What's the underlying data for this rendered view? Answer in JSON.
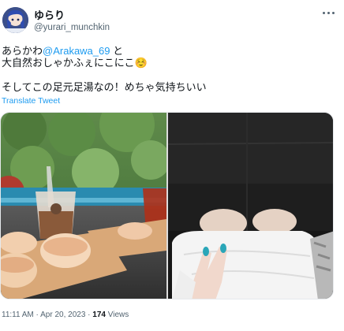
{
  "tweet": {
    "display_name": "ゆらり",
    "handle": "@yurari_munchkin",
    "line1_prefix": "あらかわ",
    "mention": "@Arakawa_69",
    "line1_suffix": " と",
    "line2": "大自然おしゃかふぇにこにこ☺️",
    "line3": "そしてこの足元足湯なの！めちゃ気持ちいい",
    "translate_label": "Translate Tweet",
    "time": "11:11 AM",
    "separator": " · ",
    "date": "Apr 20, 2023",
    "views_count": "174",
    "views_label": " Views"
  },
  "icons": {
    "more": "more-horizontal-icon"
  },
  "colors": {
    "link": "#1d9bf0",
    "secondary_text": "#536471",
    "primary_text": "#0f1419"
  }
}
